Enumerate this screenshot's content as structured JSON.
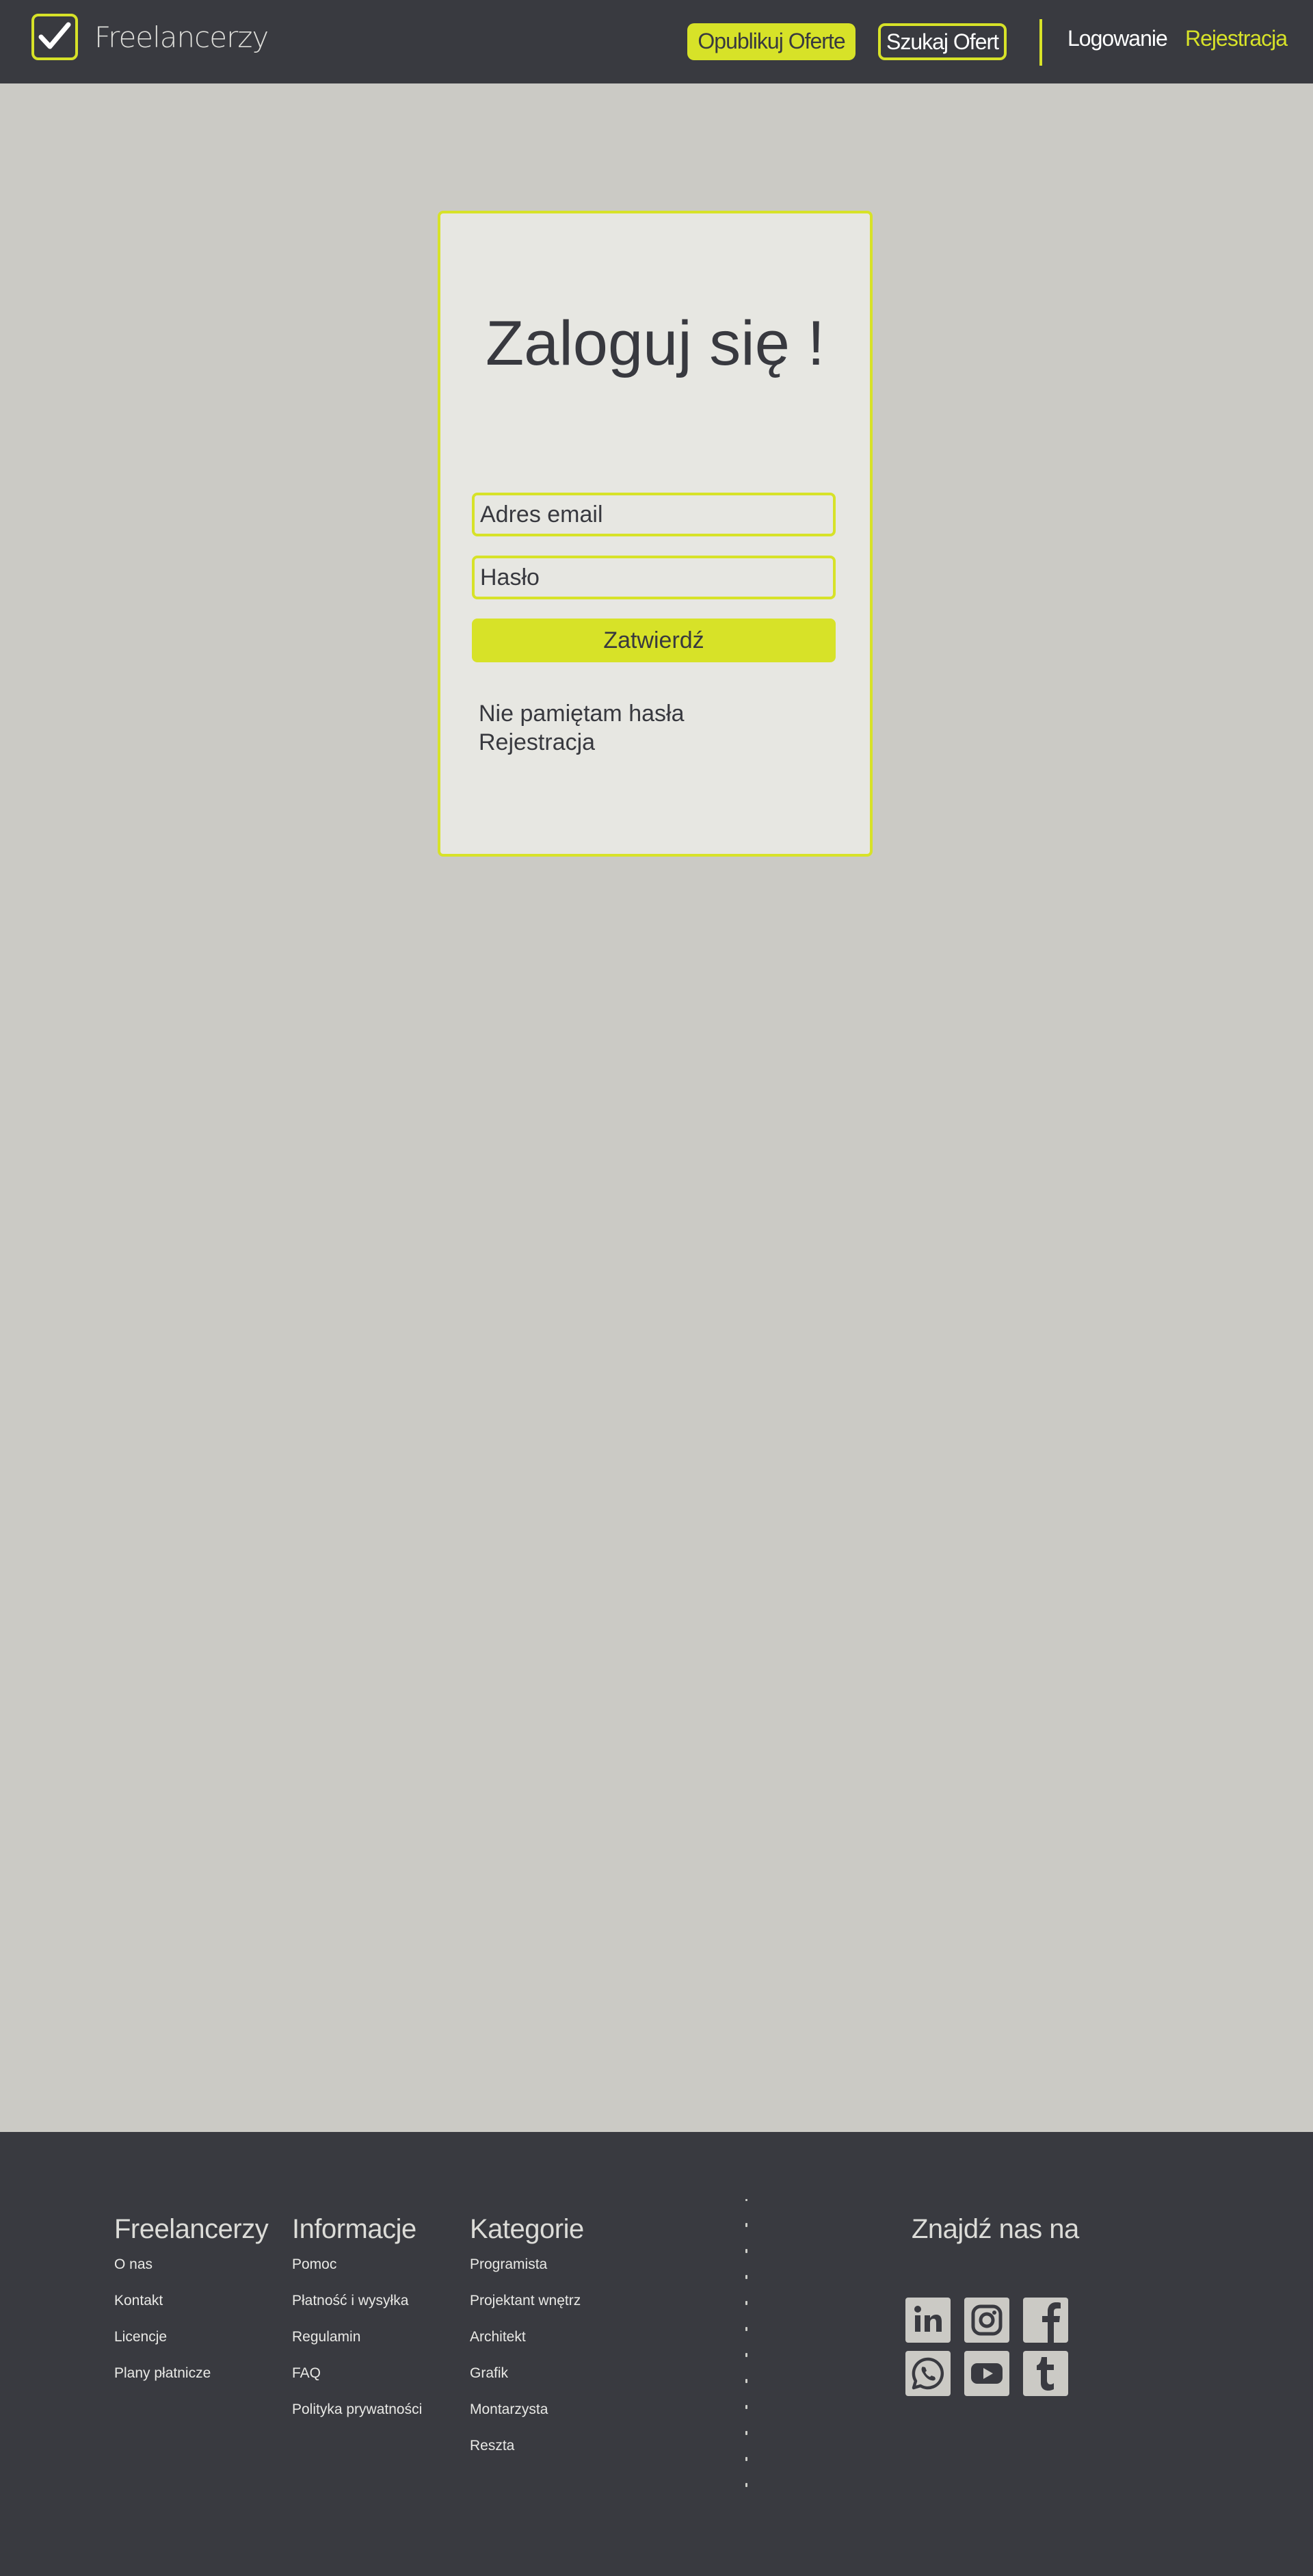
{
  "header": {
    "brand": "Freelancerzy",
    "publish_label": "Opublikuj Oferte",
    "search_label": "Szukaj Ofert",
    "login_label": "Logowanie",
    "register_label": "Rejestracja"
  },
  "login": {
    "title": "Zaloguj się !",
    "email_placeholder": "Adres email",
    "password_placeholder": "Hasło",
    "submit_label": "Zatwierdź",
    "forgot_label": "Nie pamiętam hasła",
    "register_label": "Rejestracja"
  },
  "footer": {
    "about": {
      "title": "Freelancerzy",
      "items": [
        "O nas",
        "Kontakt",
        "Licencje",
        "Plany płatnicze"
      ]
    },
    "info": {
      "title": "Informacje",
      "items": [
        "Pomoc",
        "Płatność i wysyłka",
        "Regulamin",
        "FAQ",
        "Polityka prywatności"
      ]
    },
    "categories": {
      "title": "Kategorie",
      "items": [
        "Programista",
        "Projektant wnętrz",
        "Architekt",
        "Grafik",
        "Montarzysta",
        "Reszta"
      ]
    },
    "social": {
      "title": "Znajdź nas na",
      "icons": [
        "linkedin-icon",
        "instagram-icon",
        "facebook-icon",
        "whatsapp-icon",
        "youtube-icon",
        "tumblr-icon"
      ]
    }
  },
  "colors": {
    "accent": "#d7e228",
    "header_bg": "#393a40",
    "page_bg": "#cbcac5",
    "card_bg": "#e7e7e2",
    "text_dark": "#38393f"
  }
}
